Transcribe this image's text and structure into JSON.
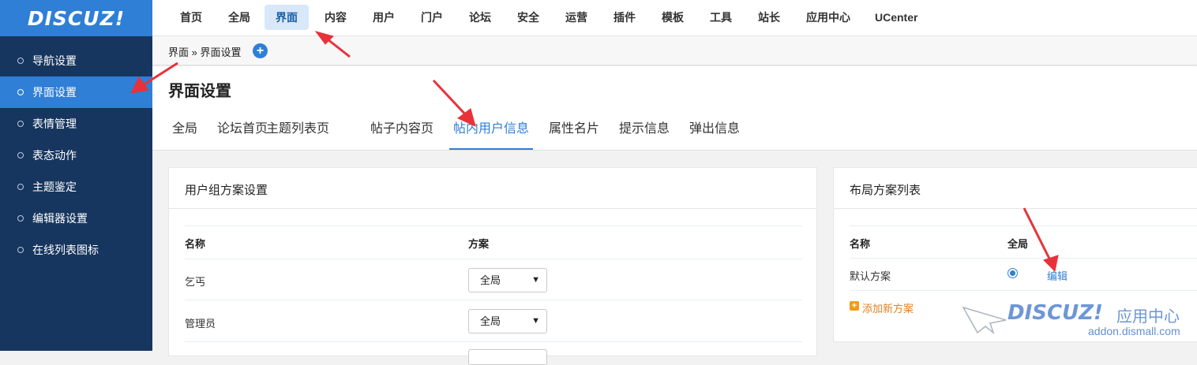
{
  "logo": "DISCUZ!",
  "top_nav": [
    "首页",
    "全局",
    "界面",
    "内容",
    "用户",
    "门户",
    "论坛",
    "安全",
    "运营",
    "插件",
    "模板",
    "工具",
    "站长",
    "应用中心",
    "UCenter"
  ],
  "top_nav_active": "界面",
  "sidebar": {
    "items": [
      {
        "label": "导航设置"
      },
      {
        "label": "界面设置",
        "active": true
      },
      {
        "label": "表情管理"
      },
      {
        "label": "表态动作"
      },
      {
        "label": "主题鉴定"
      },
      {
        "label": "编辑器设置"
      },
      {
        "label": "在线列表图标"
      }
    ]
  },
  "breadcrumb": {
    "text": "界面 » 界面设置",
    "add_icon": "plus-circle-icon"
  },
  "page_title": "界面设置",
  "tabs": [
    {
      "label": "全局"
    },
    {
      "label": "论坛首页"
    },
    {
      "label": "主题列表页"
    },
    {
      "label": "帖子内容页"
    },
    {
      "label": "帖内用户信息",
      "active": true
    },
    {
      "label": "属性名片"
    },
    {
      "label": "提示信息"
    },
    {
      "label": "弹出信息"
    }
  ],
  "usergroup_panel": {
    "title": "用户组方案设置",
    "columns": [
      "名称",
      "方案"
    ],
    "rows": [
      {
        "name": "乞丐",
        "scheme": "全局"
      },
      {
        "name": "管理员",
        "scheme": "全局"
      }
    ]
  },
  "layout_panel": {
    "title": "布局方案列表",
    "columns": [
      "名称",
      "全局"
    ],
    "rows": [
      {
        "name": "默认方案",
        "selected": true,
        "action": "编辑"
      }
    ],
    "add_label": "添加新方案"
  },
  "watermark": {
    "logo": "DISCUZ!",
    "text": "应用中心",
    "url": "addon.dismall.com"
  },
  "colors": {
    "brand": "#2f7fd6",
    "sidebar_bg": "#17365f",
    "accent_orange": "#e2811f",
    "arrow_red": "#e8323a"
  }
}
